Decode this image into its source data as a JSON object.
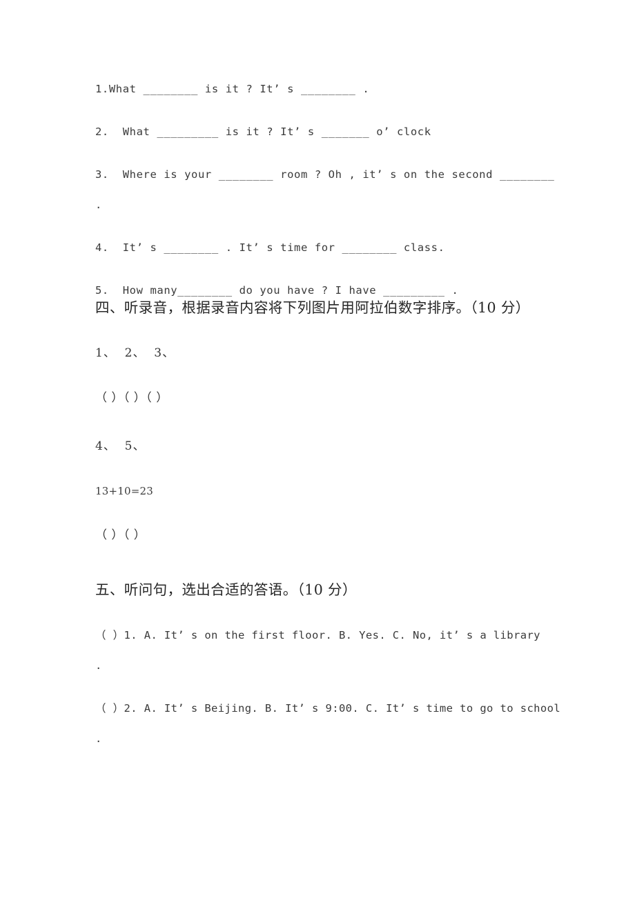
{
  "page": {
    "background_color": "#ffffff",
    "text_color": "#3a3a3a",
    "heading_color": "#262626"
  },
  "fill_in_blanks": {
    "items": [
      "1.What ________ is it ? It’ s ________ .",
      "2.  What _________ is it ? It’ s _______ o’ clock",
      "3.  Where is your ________ room ? Oh , it’ s on the second ________\n\n.",
      "4.  It’ s ________ . It’ s time for ________ class.",
      "5.  How many________ do you have ? I have _________ ."
    ]
  },
  "section_four": {
    "heading": "四、听录音，根据录音内容将下列图片用阿拉伯数字排序。（10 分）",
    "ordinals_row_one": "1、  2、  3、",
    "brackets_row_one": "（ ）（ ）（ ）",
    "ordinals_row_two": "4、  5、",
    "equation": "13+10=23",
    "brackets_row_two": "（ ）（ ）"
  },
  "section_five": {
    "heading": "五、听问句，选出合适的答语。（10 分）",
    "questions": [
      "（ ）1. A. It’ s on the first floor. B. Yes. C. No, it’ s a library\n\n.",
      "（ ）2. A. It’ s Beijing. B. It’ s 9:00. C. It’ s time to go to school\n\n."
    ]
  }
}
